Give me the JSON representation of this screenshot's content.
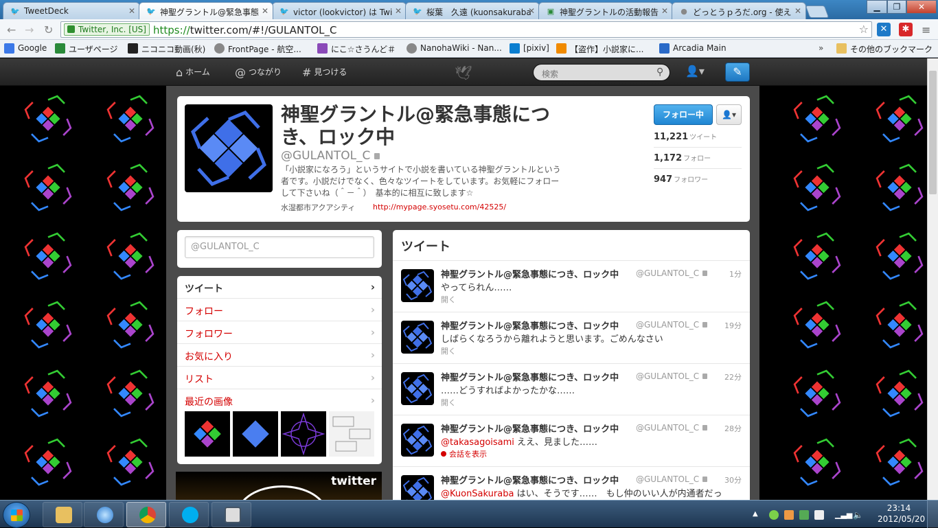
{
  "browser": {
    "tabs": [
      {
        "title": "TweetDeck",
        "active": false
      },
      {
        "title": "神聖グラントル@緊急事態",
        "active": true
      },
      {
        "title": "victor (lookvictor) は Twi",
        "active": false
      },
      {
        "title": "桜葉　久遠 (kuonsakuraba",
        "active": false
      },
      {
        "title": "神聖グラントルの活動報告",
        "active": false
      },
      {
        "title": "どっとうｐろだ.org - 使え",
        "active": false
      }
    ],
    "ssl_label": "Twitter, Inc. [US]",
    "url_scheme": "https://",
    "url_rest": "twitter.com/#!/GULANTOL_C",
    "bookmarks": [
      {
        "label": "Google",
        "color": "#3b78e7"
      },
      {
        "label": "ユーザページ",
        "color": "#2a8a3a"
      },
      {
        "label": "ニコニコ動画(秋)",
        "color": "#222222"
      },
      {
        "label": "FrontPage - 航空...",
        "color": "#888888"
      },
      {
        "label": "にこ☆さうんど＃",
        "color": "#8a4ab8"
      },
      {
        "label": "NanohaWiki - Nan...",
        "color": "#888888"
      },
      {
        "label": "[pixiv]",
        "color": "#0a7ed0"
      },
      {
        "label": "【盗作】小説家に...",
        "color": "#f08a00"
      },
      {
        "label": "Arcadia Main",
        "color": "#2a6ac8"
      }
    ],
    "other_bookmarks": "その他のブックマーク"
  },
  "twitter_nav": {
    "home": "ホーム",
    "connect": "つながり",
    "discover": "見つける",
    "search_placeholder": "検索"
  },
  "profile": {
    "name": "神聖グラントル@緊急事態につき、ロック中",
    "handle": "@GULANTOL_C",
    "bio": "「小説家になろう」というサイトで小説を書いている神聖グラントルという者です。小説だけでなく、色々なツイートをしています。お気軽にフォローして下さいね（＾－＾）　基本的に相互に致します☆",
    "location": "水湿都市アクアシティ",
    "url": "http://mypage.syosetu.com/42525/",
    "follow_button": "フォロー中",
    "stats": [
      {
        "value": "11,221",
        "label": "ツイート"
      },
      {
        "value": "1,172",
        "label": "フォロー"
      },
      {
        "value": "947",
        "label": "フォロワー"
      }
    ]
  },
  "tweetbox": {
    "placeholder": "@GULANTOL_C"
  },
  "left_nav": [
    "ツイート",
    "フォロー",
    "フォロワー",
    "お気に入り",
    "リスト",
    "最近の画像"
  ],
  "promo_logo": "twitter",
  "timeline": {
    "title": "ツイート",
    "tweets": [
      {
        "name": "神聖グラントル@緊急事態につき、ロック中",
        "handle": "@GULANTOL_C",
        "time": "1分",
        "mention": "",
        "text": "やってられん……",
        "action": "開く",
        "conversation": false
      },
      {
        "name": "神聖グラントル@緊急事態につき、ロック中",
        "handle": "@GULANTOL_C",
        "time": "19分",
        "mention": "",
        "text": "しばらくなろうから離れようと思います。ごめんなさい",
        "action": "開く",
        "conversation": false
      },
      {
        "name": "神聖グラントル@緊急事態につき、ロック中",
        "handle": "@GULANTOL_C",
        "time": "22分",
        "mention": "",
        "text": "……どうすればよかったかな……",
        "action": "開く",
        "conversation": false
      },
      {
        "name": "神聖グラントル@緊急事態につき、ロック中",
        "handle": "@GULANTOL_C",
        "time": "28分",
        "mention": "@takasagoisami",
        "text": " ええ、見ました……",
        "action": "会話を表示",
        "conversation": true
      },
      {
        "name": "神聖グラントル@緊急事態につき、ロック中",
        "handle": "@GULANTOL_C",
        "time": "30分",
        "mention": "@KuonSakuraba",
        "text": " はい、そうです……　もし仲のいい人が内通者だっ",
        "action": "",
        "conversation": false
      }
    ]
  },
  "taskbar": {
    "time": "23:14",
    "date": "2012/05/20"
  }
}
